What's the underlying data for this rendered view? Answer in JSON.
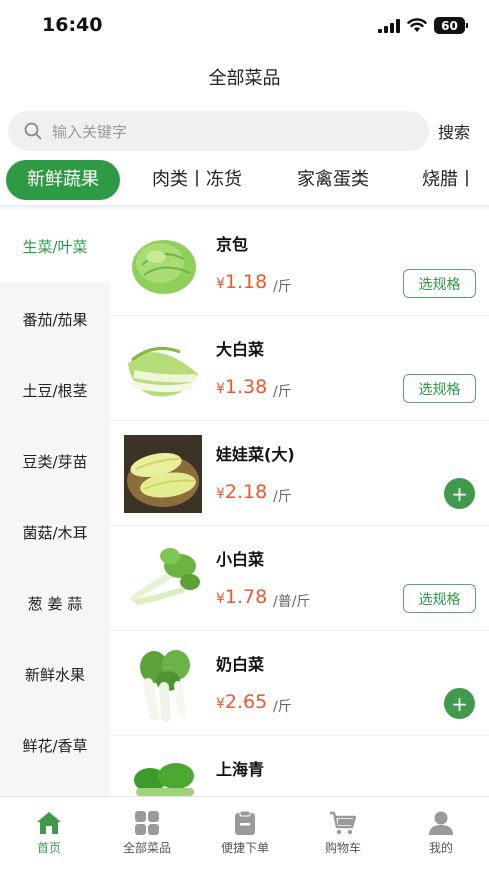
{
  "status": {
    "time": "16:40",
    "battery": "60"
  },
  "header": {
    "title": "全部菜品"
  },
  "search": {
    "placeholder": "输入关键字",
    "button_label": "搜索"
  },
  "categories": [
    "新鲜蔬果",
    "肉类丨冻货",
    "家禽蛋类",
    "烧腊丨"
  ],
  "sidebar": [
    "生菜/叶菜",
    "番茄/茄果",
    "土豆/根茎",
    "豆类/芽苗",
    "菌菇/木耳",
    "葱 姜 蒜",
    "新鲜水果",
    "鲜花/香草"
  ],
  "currency_symbol": "¥",
  "spec_label": "选规格",
  "add_label": "+",
  "products": [
    {
      "name": "京包",
      "price": "1.18",
      "unit": "/斤",
      "action": "spec"
    },
    {
      "name": "大白菜",
      "price": "1.38",
      "unit": "/斤",
      "action": "spec"
    },
    {
      "name": "娃娃菜(大)",
      "price": "2.18",
      "unit": "/斤",
      "action": "add"
    },
    {
      "name": "小白菜",
      "price": "1.78",
      "unit": "/普/斤",
      "action": "spec"
    },
    {
      "name": "奶白菜",
      "price": "2.65",
      "unit": "/斤",
      "action": "add"
    },
    {
      "name": "上海青",
      "price": "",
      "unit": "",
      "action": ""
    }
  ],
  "tabbar": [
    "首页",
    "全部菜品",
    "便捷下单",
    "购物车",
    "我的"
  ],
  "colors": {
    "accent": "#2f9a45",
    "price": "#f0572b",
    "sidebar_bg": "#f6f6f6"
  },
  "icons": [
    "signal-icon",
    "wifi-icon",
    "battery-icon",
    "search-icon",
    "home-icon",
    "grid-icon",
    "clipboard-icon",
    "cart-icon",
    "user-icon"
  ]
}
